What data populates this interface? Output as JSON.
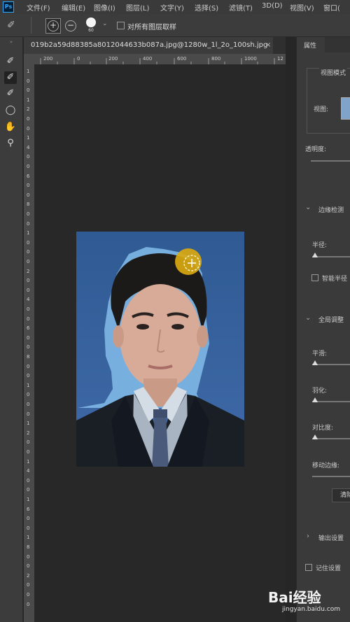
{
  "app": {
    "logo": "Ps"
  },
  "menu": [
    "文件(F)",
    "编辑(E)",
    "图像(I)",
    "图层(L)",
    "文字(Y)",
    "选择(S)",
    "滤镜(T)",
    "3D(D)",
    "视图(V)",
    "窗口("
  ],
  "options": {
    "brush_size": "60",
    "sample_all_layers_label": "对所有图层取样"
  },
  "document": {
    "tab_title": "019b2a59d88385a8012044633b087a.jpg@1280w_1l_2o_100sh.jpg",
    "close_glyph": "×"
  },
  "ruler": {
    "h_ticks": [
      "200",
      "0",
      "200",
      "400",
      "600",
      "800",
      "1000",
      "12"
    ],
    "v_ticks": [
      "1",
      "0",
      "0",
      "1",
      "2",
      "0",
      "0",
      "1",
      "4",
      "0",
      "0",
      "6",
      "0",
      "0",
      "8",
      "0",
      "0",
      "1",
      "0",
      "0",
      "0",
      "2",
      "0",
      "0",
      "4",
      "0",
      "0",
      "6",
      "0",
      "0",
      "8",
      "0",
      "0",
      "1",
      "0",
      "0",
      "0",
      "1",
      "2",
      "0",
      "0",
      "1",
      "4",
      "0",
      "0",
      "1",
      "6",
      "0",
      "0",
      "1",
      "8",
      "0",
      "0",
      "2",
      "0",
      "0",
      "0"
    ]
  },
  "panel": {
    "tab_label": "属性",
    "view_mode_label": "视图模式",
    "view_label": "视图:",
    "transparency_label": "透明度:",
    "edge_detection_label": "边缘检测",
    "radius_label": "半径:",
    "smart_radius_label": "智能半径",
    "global_adjust_label": "全局调整",
    "smooth_label": "平滑:",
    "feather_label": "羽化:",
    "contrast_label": "对比度:",
    "shift_edge_label": "移动边缘:",
    "clear_button": "清除",
    "output_settings_label": "输出设置",
    "remember_settings_label": "记住设置"
  },
  "watermark": {
    "brand": "Bai经验",
    "url": "jingyan.baidu.com"
  }
}
